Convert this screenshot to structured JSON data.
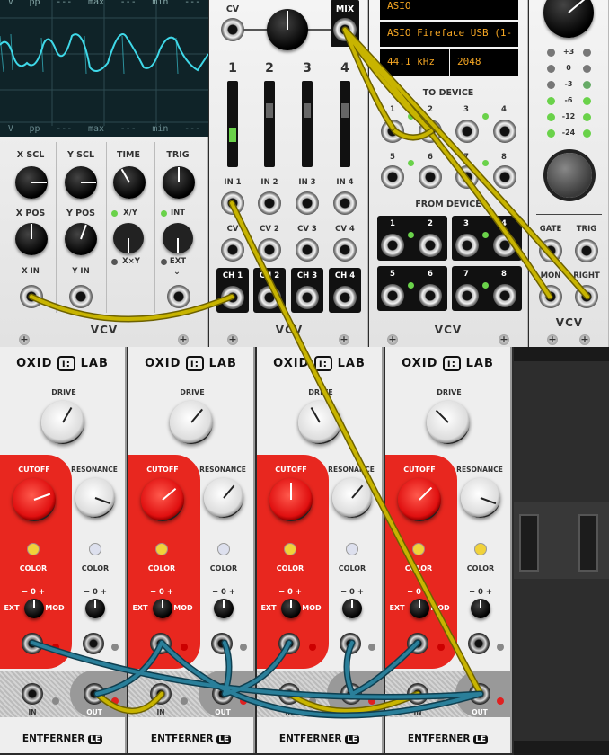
{
  "scope": {
    "top_labels": [
      "V",
      "pp",
      "---",
      "max",
      "---",
      "min",
      "---"
    ],
    "bottom_labels": [
      "V",
      "pp",
      "---",
      "max",
      "---",
      "min",
      "---"
    ],
    "controls": {
      "x_scl": "X SCL",
      "y_scl": "Y SCL",
      "time": "TIME",
      "trig": "TRIG",
      "x_pos": "X POS",
      "y_pos": "Y POS",
      "xy": "X/Y",
      "xxy": "X×Y",
      "int": "INT",
      "ext": "EXT",
      "x_in": "X IN",
      "y_in": "Y IN"
    },
    "brand": "VCV",
    "trace_color": "#3fd8e8"
  },
  "mixer": {
    "cv_label": "CV",
    "mix_label": "MIX",
    "channels": [
      "1",
      "2",
      "3",
      "4"
    ],
    "ins": [
      "IN 1",
      "IN 2",
      "IN 3",
      "IN 4"
    ],
    "cvs": [
      "CV",
      "CV 2",
      "CV 3",
      "CV 4"
    ],
    "chs": [
      "CH 1",
      "CH 2",
      "CH 3",
      "CH 4"
    ],
    "brand": "VCV"
  },
  "audio": {
    "driver": "ASIO",
    "device": "ASIO Fireface USB (1-",
    "sample_rate": "44.1 kHz",
    "block": "2048",
    "to_device": "TO DEVICE",
    "from_device": "FROM DEVICE",
    "to_nums": [
      "1",
      "2",
      "3",
      "4",
      "5",
      "6",
      "7",
      "8"
    ],
    "from_nums": [
      "1",
      "2",
      "3",
      "4",
      "5",
      "6",
      "7",
      "8"
    ],
    "brand": "VCV"
  },
  "vu": {
    "levels": [
      "+3",
      "0",
      "-3",
      "-6",
      "-12",
      "-24"
    ],
    "gate": "GATE",
    "trig": "TRIG",
    "mon": "MON",
    "right": "RIGHT",
    "brand": "VCV"
  },
  "filters": {
    "brand": "OXID",
    "brand2": "LAB",
    "drive": "DRIVE",
    "cutoff": "CUTOFF",
    "resonance": "RESONANCE",
    "color": "COLOR",
    "minus0plus": "− 0 +",
    "ext": "EXT",
    "mod": "MOD",
    "in": "IN",
    "out": "OUT",
    "name": "ENTFERNER",
    "badge": "LE"
  },
  "colors": {
    "yellow_cable": "#c8b400",
    "blue_cable": "#2a7f9a",
    "oxid_red": "#e8271f",
    "display_amber": "#f5a623"
  }
}
